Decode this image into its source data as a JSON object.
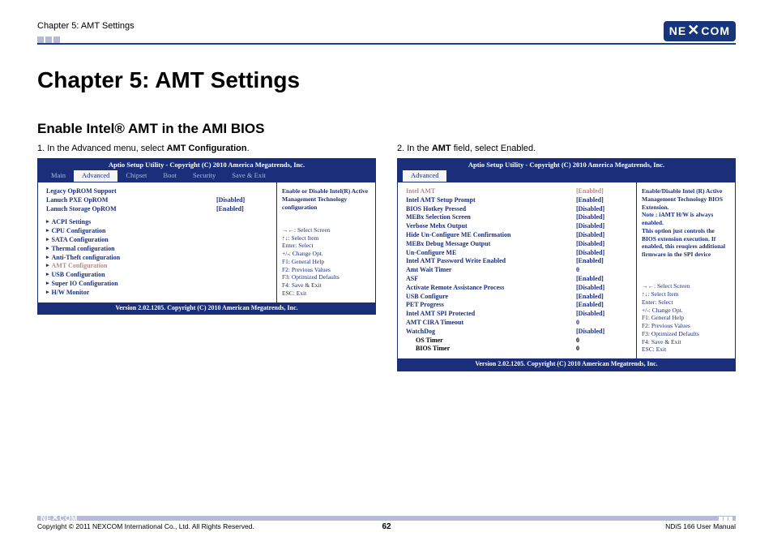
{
  "header": {
    "chapter_label": "Chapter 5: AMT Settings",
    "logo_text_pre": "NE",
    "logo_text_x": "✕",
    "logo_text_post": "COM"
  },
  "title": "Chapter 5: AMT Settings",
  "section": "Enable Intel® AMT in the AMI BIOS",
  "step1": {
    "prefix": "1. In the Advanced menu, select ",
    "bold": "AMT Configuration",
    "suffix": "."
  },
  "step2": {
    "prefix": "2. In the ",
    "bold": "AMT",
    "suffix": " field, select Enabled."
  },
  "bios_common": {
    "title": "Aptio Setup Utility - Copyright (C) 2010 America Megatrends, Inc.",
    "footer": "Version 2.02.1205. Copyright (C) 2010 American Megatrends, Inc.",
    "tabs": [
      "Main",
      "Advanced",
      "Chipset",
      "Boot",
      "Security",
      "Save & Exit"
    ],
    "keys": [
      "→←: Select Screen",
      "↑↓: Select Item",
      "Enter: Select",
      "+/-: Change Opt.",
      "F1: General Help",
      "F2: Previous Values",
      "F3: Optimized Defaults",
      "F4: Save & Exit",
      "ESC: Exit"
    ]
  },
  "bios1": {
    "help": "Enable or Disable Intel(R) Active Management Technology configuration",
    "rows": [
      {
        "label": "Legacy OpROM Support",
        "val": "",
        "type": "plain"
      },
      {
        "label": "Lanuch PXE OpROM",
        "val": "[Disabled]",
        "type": "plain"
      },
      {
        "label": "Lanuch Storage OpROM",
        "val": "[Enabled]",
        "type": "plain"
      },
      {
        "label": "",
        "val": "",
        "type": "spacer"
      },
      {
        "label": "ACPI Settings",
        "val": "",
        "type": "menu"
      },
      {
        "label": "CPU Configuration",
        "val": "",
        "type": "menu"
      },
      {
        "label": "SATA Configuration",
        "val": "",
        "type": "menu"
      },
      {
        "label": "Thermal configuration",
        "val": "",
        "type": "menu"
      },
      {
        "label": "Anti-Theft configuration",
        "val": "",
        "type": "menu"
      },
      {
        "label": "AMT Configuration",
        "val": "",
        "type": "menu-sel"
      },
      {
        "label": "USB Configuration",
        "val": "",
        "type": "menu"
      },
      {
        "label": "Super IO Configuration",
        "val": "",
        "type": "menu"
      },
      {
        "label": "H/W Monitor",
        "val": "",
        "type": "menu"
      }
    ]
  },
  "bios2": {
    "help": "Enable/Disable Intel (R) Active Management Technology BIOS Extension.\nNote : iAMT H/W is always enabled.\nThis option just controls the BIOS extension execution. If enabled, this reuqires additional firmware in the SPI device",
    "rows": [
      {
        "label": "Intel AMT",
        "val": "[Enabled]",
        "type": "sel"
      },
      {
        "label": "Intel AMT Setup Prompt",
        "val": "[Enabled]",
        "type": "plain"
      },
      {
        "label": "BIOS Hotkey Pressed",
        "val": "[Disabled]",
        "type": "plain"
      },
      {
        "label": "MEBx Selection Screen",
        "val": "[Disabled]",
        "type": "plain"
      },
      {
        "label": "Verbose Mebx Output",
        "val": "[Disabled]",
        "type": "plain"
      },
      {
        "label": "Hide Un-Configure ME Confirmation",
        "val": "[Disabled]",
        "type": "plain"
      },
      {
        "label": "MEBx Debug Message Output",
        "val": "[Disabled]",
        "type": "plain"
      },
      {
        "label": "Un-Configure ME",
        "val": "[Disabled]",
        "type": "plain"
      },
      {
        "label": "Intel AMT Password Write Enabled",
        "val": "[Enabled]",
        "type": "plain"
      },
      {
        "label": "Amt Wait Timer",
        "val": "0",
        "type": "plain"
      },
      {
        "label": "ASF",
        "val": "[Enabled]",
        "type": "plain"
      },
      {
        "label": "Activate Remote Assistance Process",
        "val": "[Disabled]",
        "type": "plain"
      },
      {
        "label": "USB Configure",
        "val": "[Enabled]",
        "type": "plain"
      },
      {
        "label": "PET Progress",
        "val": "[Enabled]",
        "type": "plain"
      },
      {
        "label": "Intel AMT SPI Protected",
        "val": "[Disabled]",
        "type": "plain"
      },
      {
        "label": "AMT CIRA Timeout",
        "val": "0",
        "type": "plain"
      },
      {
        "label": "WatchDog",
        "val": "[Disabled]",
        "type": "plain"
      },
      {
        "label": "OS Timer",
        "val": "0",
        "type": "indent"
      },
      {
        "label": "BIOS Timer",
        "val": "0",
        "type": "indent"
      }
    ]
  },
  "footer": {
    "copyright": "Copyright © 2011 NEXCOM International Co., Ltd. All Rights Reserved.",
    "page": "62",
    "manual": "NDiS 166 User Manual"
  }
}
